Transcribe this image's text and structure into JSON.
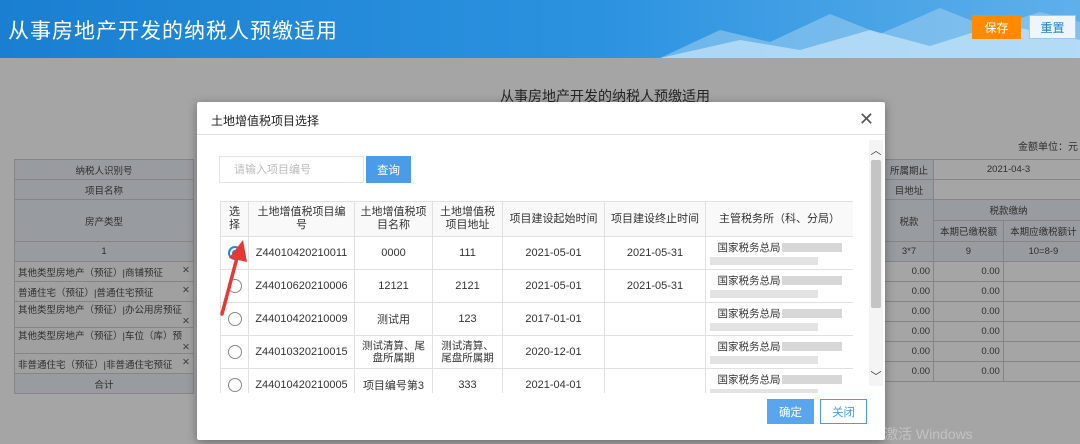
{
  "header": {
    "title": "从事房地产开发的纳税人预缴适用",
    "save_label": "保存",
    "reset_label": "重置"
  },
  "form": {
    "title": "从事房地产开发的纳税人预缴适用",
    "unit": "金额单位：元",
    "labels": {
      "taxpayer_id": "纳税人识别号",
      "project_name": "项目名称",
      "property_type": "房产类型",
      "col_index": "1",
      "total": "合计",
      "period_end": "所属期止",
      "period_end_value": "2021-04-3",
      "address": "目地址",
      "tax_amount": "税款",
      "tax_payment": "税款缴纳",
      "paid_this_period": "本期已缴税额",
      "payable_this_period": "本期应缴税额计",
      "formula_a": "3*7",
      "formula_b": "9",
      "formula_c": "10=8-9"
    },
    "rows": [
      {
        "type": "其他类型房地产（预征）|商铺预征",
        "v1": "0.00",
        "v2": "0.00"
      },
      {
        "type": "普通住宅（预征）|普通住宅预征",
        "v1": "0.00",
        "v2": "0.00"
      },
      {
        "type": "其他类型房地产（预征）|办公用房预征",
        "v1": "0.00",
        "v2": "0.00"
      },
      {
        "type": "其他类型房地产（预征）|车位（库）预",
        "v1": "0.00",
        "v2": "0.00"
      },
      {
        "type": "非普通住宅（预征）|非普通住宅预征",
        "v1": "0.00",
        "v2": "0.00"
      },
      {
        "type": "",
        "v1": "0.00",
        "v2": "0.00"
      }
    ]
  },
  "dialog": {
    "title": "土地增值税项目选择",
    "search_placeholder": "请输入项目编号",
    "search_button": "查询",
    "columns": [
      "选择",
      "土地增值税项目编号",
      "土地增值税项目名称",
      "土地增值税项目地址",
      "项目建设起始时间",
      "项目建设终止时间",
      "主管税务所（科、分局）"
    ],
    "rows": [
      {
        "selected": true,
        "code": "Z44010420210011",
        "name": "0000",
        "address": "111",
        "start": "2021-05-01",
        "end": "2021-05-31",
        "office": "国家税务总局"
      },
      {
        "selected": false,
        "code": "Z44010620210006",
        "name": "12121",
        "address": "2121",
        "start": "2021-05-01",
        "end": "2021-05-31",
        "office": "国家税务总局"
      },
      {
        "selected": false,
        "code": "Z44010420210009",
        "name": "测试用",
        "address": "123",
        "start": "2017-01-01",
        "end": "",
        "office": "国家税务总局"
      },
      {
        "selected": false,
        "code": "Z44010320210015",
        "name": "测试清算、尾盘所属期",
        "address": "测试清算、尾盘所属期",
        "start": "2020-12-01",
        "end": "",
        "office": "国家税务总局"
      },
      {
        "selected": false,
        "code": "Z44010420210005",
        "name": "项目编号第3",
        "address": "333",
        "start": "2021-04-01",
        "end": "",
        "office": "国家税务总局"
      }
    ],
    "ok_button": "确定",
    "close_button": "关闭"
  },
  "watermark": "激活 Windows",
  "colors": {
    "header_blue": "#1a7fd0",
    "save_orange": "#ff8a00",
    "primary_blue": "#4a9be8",
    "annotation_red": "#e53935"
  }
}
